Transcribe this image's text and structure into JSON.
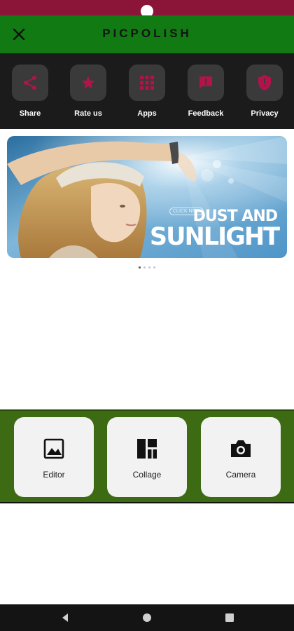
{
  "app": {
    "title": "PICPOLISH"
  },
  "actions": [
    {
      "label": "Share",
      "icon": "share-icon"
    },
    {
      "label": "Rate us",
      "icon": "star-icon"
    },
    {
      "label": "Apps",
      "icon": "apps-grid-icon"
    },
    {
      "label": "Feedback",
      "icon": "feedback-icon"
    },
    {
      "label": "Privacy",
      "icon": "shield-icon"
    }
  ],
  "banner": {
    "tag": "CLICK NEW",
    "line1": "DUST AND",
    "line2": "SUNLIGHT"
  },
  "carousel": {
    "pages": 4,
    "active": 0
  },
  "tools": [
    {
      "label": "Editor",
      "icon": "image-icon"
    },
    {
      "label": "Collage",
      "icon": "collage-icon"
    },
    {
      "label": "Camera",
      "icon": "camera-icon"
    }
  ],
  "nav": [
    "back-icon",
    "home-icon",
    "recents-icon"
  ],
  "colors": {
    "status_bar": "#8a1538",
    "app_bar": "#127a12",
    "accent": "#b0144a",
    "tools_bg": "#3d6b13"
  }
}
